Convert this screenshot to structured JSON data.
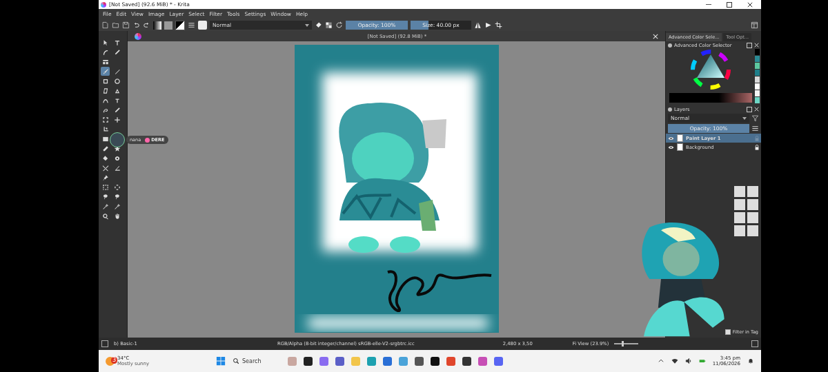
{
  "window": {
    "title": "[Not Saved]  (92.6 MiB) * - Krita"
  },
  "menu": [
    "File",
    "Edit",
    "View",
    "Image",
    "Layer",
    "Select",
    "Filter",
    "Tools",
    "Settings",
    "Window",
    "Help"
  ],
  "toolbar": {
    "blend_mode": "Normal",
    "opacity": {
      "label": "Opacity: 100%",
      "level": 1
    },
    "size": {
      "label": "Size: 40.00 px",
      "level": 0.3
    }
  },
  "document_tab": {
    "title": "[Not Saved]  (92.8 MiB) *"
  },
  "tools": [
    {
      "selected": false
    },
    {
      "selected": false
    },
    {
      "selected": false
    },
    {
      "selected": false
    },
    {
      "selected": false
    },
    {
      "selected": true
    },
    {
      "selected": false
    },
    {
      "selected": false
    },
    {
      "selected": false
    },
    {
      "selected": false
    },
    {
      "selected": false
    },
    {
      "selected": false
    },
    {
      "selected": false
    },
    {
      "selected": false
    },
    {
      "selected": false
    },
    {
      "selected": false
    },
    {
      "selected": false
    },
    {
      "selected": false
    },
    {
      "selected": false
    },
    {
      "selected": false
    },
    {
      "selected": false
    },
    {
      "selected": false
    },
    {
      "selected": false
    },
    {
      "selected": false
    },
    {
      "selected": false
    },
    {
      "selected": false
    },
    {
      "selected": false
    },
    {
      "selected": false
    },
    {
      "selected": false
    },
    {
      "selected": false
    },
    {
      "selected": false
    },
    {
      "selected": false
    },
    {
      "selected": false
    },
    {
      "selected": false
    }
  ],
  "overlay": {
    "name": "nana",
    "tag": "DERE"
  },
  "docker": {
    "tabs": [
      {
        "label": "Advanced Color Sele...",
        "selected": true
      },
      {
        "label": "Tool Opt...",
        "selected": false
      }
    ],
    "color_selector": {
      "title": "Advanced Color Selector",
      "swatches": [
        {
          "color": "#000000"
        },
        {
          "color": "#2a8a94"
        },
        {
          "color": "#5cc8a0"
        },
        {
          "color": "#1f7f8a"
        },
        {
          "color": "#d9d9d9"
        },
        {
          "color": "#ffffff"
        },
        {
          "color": "#f4f4f4"
        },
        {
          "color": "#6dd5c4"
        }
      ]
    },
    "layers": {
      "title": "Layers",
      "blend_mode": "Normal",
      "opacity": {
        "label": "Opacity: 100%",
        "level": 1
      },
      "items": [
        {
          "name": "Paint Layer 1",
          "selected": true,
          "visible": true,
          "locked": false
        },
        {
          "name": "Background",
          "selected": false,
          "visible": true,
          "locked": true
        }
      ]
    },
    "brush_presets": {
      "filter_in_tag": {
        "label": "Filter in Tag",
        "checked": true
      }
    }
  },
  "status_bar": {
    "brush": "b) Basic-1",
    "color_space": "RGB/Alpha (8-bit integer/channel)  sRGB-elle-V2-srgbtrc.icc",
    "dimensions": "2,480 x 3,50",
    "zoom": "Fi View (23.9%)",
    "zoom_slider": {
      "level": 0.3
    }
  },
  "taskbar": {
    "weather": {
      "temperature": "34°C",
      "condition": "Mostly sunny",
      "badge": "3"
    },
    "search": {
      "placeholder": "Search"
    },
    "clock": {
      "time": "3:45 pm",
      "date": "11/06/2026"
    }
  }
}
